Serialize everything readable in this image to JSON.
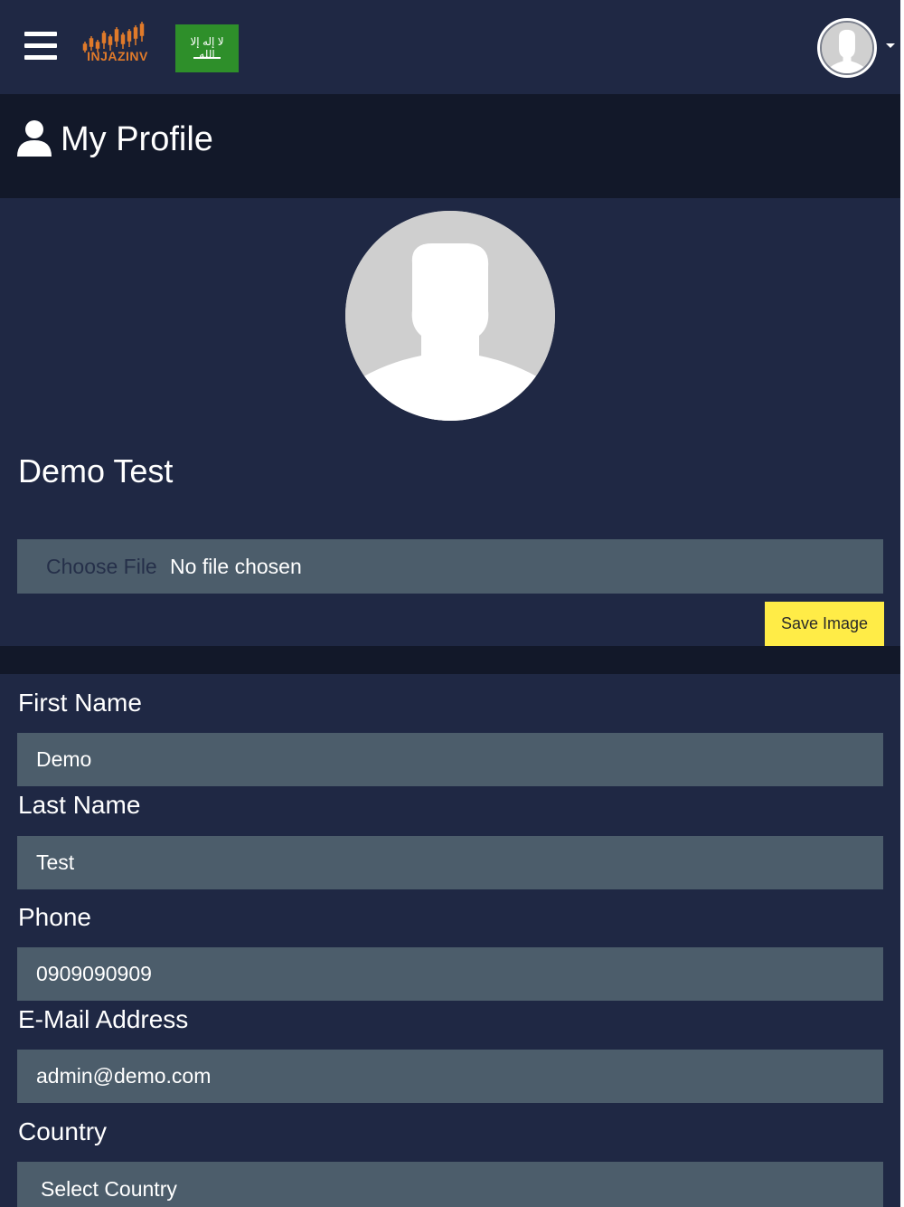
{
  "navbar": {
    "logo_text": "INJAZINV",
    "flag_script": "لا إله إلا الله"
  },
  "header": {
    "title": "My Profile"
  },
  "profile": {
    "name": "Demo Test",
    "file_button_label": "Choose File",
    "file_status": "No file chosen",
    "save_button_label": "Save Image"
  },
  "form": {
    "first_name_label": "First Name",
    "first_name_value": "Demo",
    "last_name_label": "Last Name",
    "last_name_value": "Test",
    "phone_label": "Phone",
    "phone_value": "0909090909",
    "email_label": "E-Mail Address",
    "email_value": "admin@demo.com",
    "country_label": "Country",
    "country_value": "Select Country"
  },
  "colors": {
    "background": "#1f2844",
    "title_band": "#121829",
    "input_bg": "#4c5d6b",
    "save_button": "#ffec47",
    "logo_orange": "#e07a2a",
    "flag_green": "#2e8f2a"
  }
}
